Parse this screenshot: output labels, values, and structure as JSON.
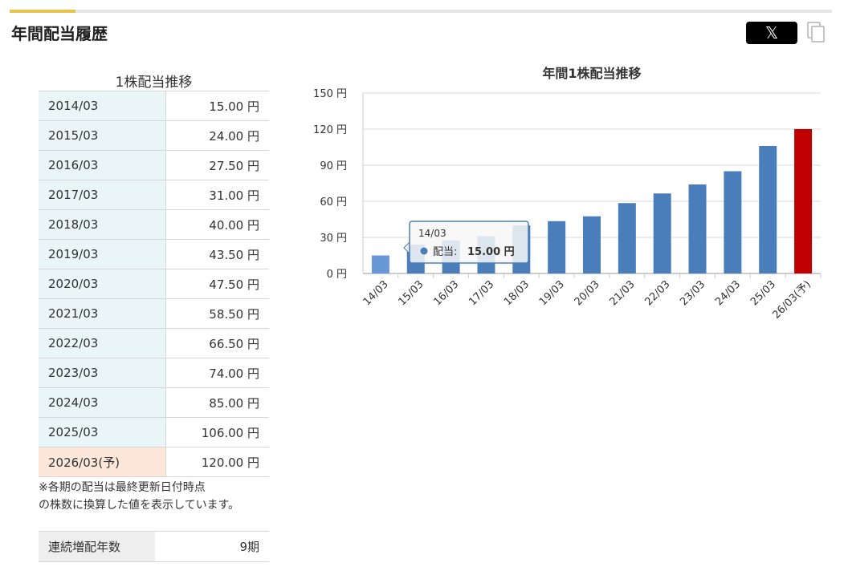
{
  "section": {
    "title": "年間配当履歴"
  },
  "share": {
    "x_label": "𝕏"
  },
  "table": {
    "caption": "1株配当推移",
    "rows": [
      {
        "period": "2014/03",
        "amount": "15.00 円"
      },
      {
        "period": "2015/03",
        "amount": "24.00 円"
      },
      {
        "period": "2016/03",
        "amount": "27.50 円"
      },
      {
        "period": "2017/03",
        "amount": "31.00 円"
      },
      {
        "period": "2018/03",
        "amount": "40.00 円"
      },
      {
        "period": "2019/03",
        "amount": "43.50 円"
      },
      {
        "period": "2020/03",
        "amount": "47.50 円"
      },
      {
        "period": "2021/03",
        "amount": "58.50 円"
      },
      {
        "period": "2022/03",
        "amount": "66.50 円"
      },
      {
        "period": "2023/03",
        "amount": "74.00 円"
      },
      {
        "period": "2024/03",
        "amount": "85.00 円"
      },
      {
        "period": "2025/03",
        "amount": "106.00 円"
      },
      {
        "period": "2026/03(予)",
        "amount": "120.00 円"
      }
    ],
    "note_line1": "※各期の配当は最終更新日付時点",
    "note_line2": "の株数に換算した値を表示しています。"
  },
  "streak": {
    "label": "連続増配年数",
    "value": "9期"
  },
  "chart_data": {
    "type": "bar",
    "title": "年間1株配当推移",
    "categories": [
      "14/03",
      "15/03",
      "16/03",
      "17/03",
      "18/03",
      "19/03",
      "20/03",
      "21/03",
      "22/03",
      "23/03",
      "24/03",
      "25/03",
      "26/03(予)"
    ],
    "series": [
      {
        "name": "配当",
        "values": [
          15.0,
          24.0,
          27.5,
          31.0,
          40.0,
          43.5,
          47.5,
          58.5,
          66.5,
          74.0,
          85.0,
          106.0,
          120.0
        ]
      }
    ],
    "forecast_index": 12,
    "highlight_index": 0,
    "ylim": [
      0,
      150
    ],
    "yticks": [
      0,
      30,
      60,
      90,
      120,
      150
    ],
    "ytick_labels": [
      "0 円",
      "30 円",
      "60 円",
      "90 円",
      "120 円",
      "150 円"
    ],
    "grid": true,
    "colors": {
      "bar": "#4a7ebb",
      "bar_hover": "#6898d8",
      "forecast": "#c00000",
      "grid": "#d9d9d9"
    },
    "tooltip": {
      "category": "14/03",
      "series_label": "配当: ",
      "value_text": "15.00 円"
    }
  }
}
